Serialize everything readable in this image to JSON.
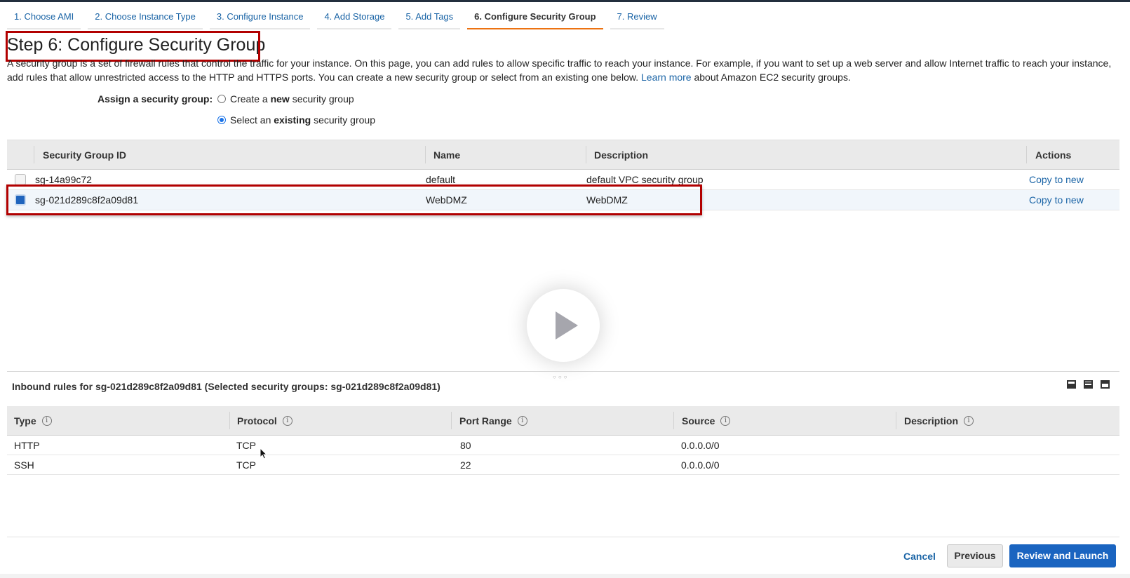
{
  "wizard": {
    "tabs": [
      {
        "label": "1. Choose AMI"
      },
      {
        "label": "2. Choose Instance Type"
      },
      {
        "label": "3. Configure Instance"
      },
      {
        "label": "4. Add Storage"
      },
      {
        "label": "5. Add Tags"
      },
      {
        "label": "6. Configure Security Group",
        "active": true
      },
      {
        "label": "7. Review"
      }
    ]
  },
  "page": {
    "title": "Step 6: Configure Security Group",
    "intro_text": "A security group is a set of firewall rules that control the traffic for your instance. On this page, you can add rules to allow specific traffic to reach your instance. For example, if you want to set up a web server and allow Internet traffic to reach your instance, add rules that allow unrestricted access to the HTTP and HTTPS ports. You can create a new security group or select from an existing one below.",
    "learn_more": "Learn more",
    "intro_suffix": "about Amazon EC2 security groups."
  },
  "assign": {
    "label": "Assign a security group:",
    "option_new_pre": "Create a",
    "option_new_bold": "new",
    "option_new_post": "security group",
    "option_existing_pre": "Select an",
    "option_existing_bold": "existing",
    "option_existing_post": "security group",
    "selected": "existing"
  },
  "sg_table": {
    "headers": {
      "id": "Security Group ID",
      "name": "Name",
      "description": "Description",
      "actions": "Actions"
    },
    "rows": [
      {
        "id": "sg-14a99c72",
        "name": "default",
        "description": "default VPC security group",
        "action": "Copy to new",
        "checked": false
      },
      {
        "id": "sg-021d289c8f2a09d81",
        "name": "WebDMZ",
        "description": "WebDMZ",
        "action": "Copy to new",
        "checked": true
      }
    ]
  },
  "inbound": {
    "title": "Inbound rules for sg-021d289c8f2a09d81 (Selected security groups: sg-021d289c8f2a09d81)",
    "headers": {
      "type": "Type",
      "protocol": "Protocol",
      "port_range": "Port Range",
      "source": "Source",
      "description": "Description"
    },
    "rows": [
      {
        "type": "HTTP",
        "protocol": "TCP",
        "port_range": "80",
        "source": "0.0.0.0/0",
        "description": ""
      },
      {
        "type": "SSH",
        "protocol": "TCP",
        "port_range": "22",
        "source": "0.0.0.0/0",
        "description": ""
      }
    ],
    "info_glyph": "i"
  },
  "footer": {
    "cancel": "Cancel",
    "previous": "Previous",
    "review_launch": "Review and Launch"
  },
  "icons": {
    "play": "play-icon",
    "info": "info-icon",
    "panel_layouts": [
      "panel-bottom-icon",
      "panel-split-icon",
      "panel-top-icon"
    ]
  },
  "colors": {
    "link": "#1a64a6",
    "active_tab_underline": "#ec7211",
    "highlight_box": "#b20000",
    "primary_button": "#1a64c0"
  }
}
